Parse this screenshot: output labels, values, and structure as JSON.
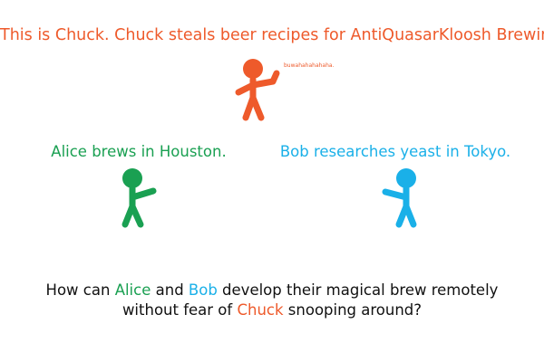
{
  "colors": {
    "chuck": "#ee5a2b",
    "alice": "#1aa052",
    "bob": "#1ab0e8",
    "text": "#111111",
    "background": "#ffffff"
  },
  "chuck": {
    "caption": "This is Chuck. Chuck steals beer recipes for AntiQuasarKloosh Brewing.",
    "laugh": "buwahahahahaha."
  },
  "alice": {
    "caption": "Alice brews in Houston."
  },
  "bob": {
    "caption": "Bob researches yeast in Tokyo."
  },
  "question": {
    "line1": {
      "p1": "How can ",
      "alice": "Alice",
      "p2": " and ",
      "bob": "Bob",
      "p3": " develop their magical brew remotely"
    },
    "line2": {
      "p1": "without fear of ",
      "chuck": "Chuck",
      "p2": " snooping around?"
    }
  }
}
